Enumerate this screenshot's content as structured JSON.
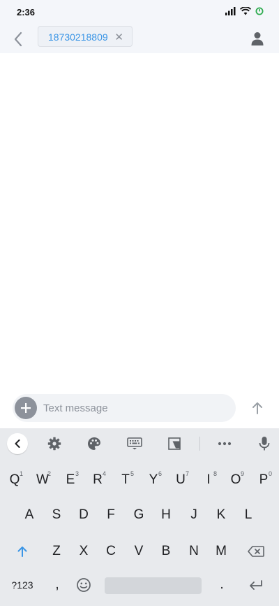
{
  "status_bar": {
    "time": "2:36"
  },
  "header": {
    "recipient": "18730218809",
    "chip_close": "✕"
  },
  "compose": {
    "placeholder": "Text message"
  },
  "keyboard": {
    "row1": [
      {
        "label": "Q",
        "hint": "1"
      },
      {
        "label": "W",
        "hint": "2"
      },
      {
        "label": "E",
        "hint": "3"
      },
      {
        "label": "R",
        "hint": "4"
      },
      {
        "label": "T",
        "hint": "5"
      },
      {
        "label": "Y",
        "hint": "6"
      },
      {
        "label": "U",
        "hint": "7"
      },
      {
        "label": "I",
        "hint": "8"
      },
      {
        "label": "O",
        "hint": "9"
      },
      {
        "label": "P",
        "hint": "0"
      }
    ],
    "row2": [
      "A",
      "S",
      "D",
      "F",
      "G",
      "H",
      "J",
      "K",
      "L"
    ],
    "row3": [
      "Z",
      "X",
      "C",
      "V",
      "B",
      "N",
      "M"
    ],
    "symbols_label": "?123",
    "comma": ",",
    "period": "."
  },
  "colors": {
    "accent": "#3a95e6",
    "keyboard_bg": "#e8eaed",
    "header_bg": "#f4f6fa"
  }
}
